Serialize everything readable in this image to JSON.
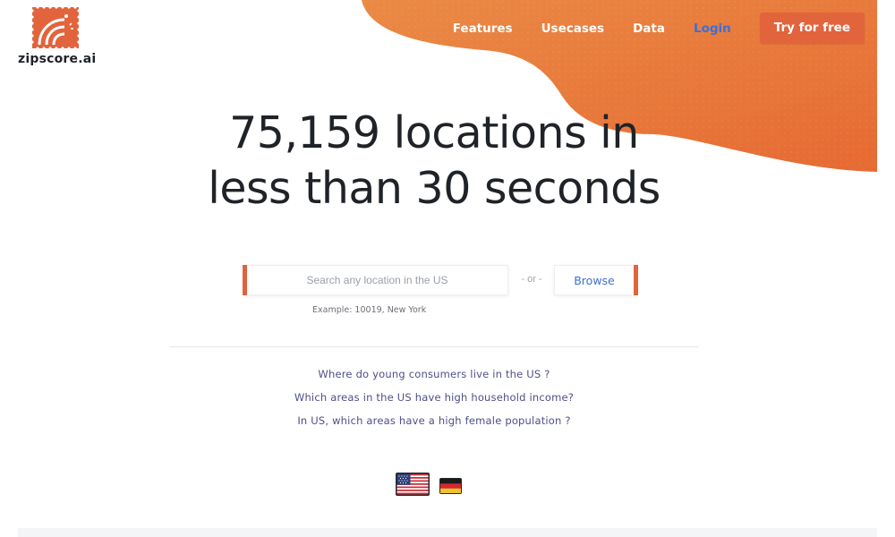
{
  "brand": {
    "name": "zipscore.ai",
    "accent": "#e2643c",
    "blob_color": "#e8773a",
    "link_blue": "#3d6fd4",
    "question_color": "#4f4e8a",
    "logo_icon": "location-pin-stamp-icon"
  },
  "nav": {
    "features": "Features",
    "usecases": "Usecases",
    "data": "Data",
    "login": "Login",
    "cta": "Try for free"
  },
  "hero": {
    "line1": "75,159 locations in",
    "line2": "less than 30 seconds"
  },
  "search": {
    "placeholder": "Search any location in the US",
    "value": "",
    "or_label": "- or -",
    "browse_label": "Browse",
    "example": "Example: 10019, New York"
  },
  "questions": [
    "Where do young consumers live in the US ?",
    "Which areas in the US have high household income?",
    "In US, which areas have a high female population ?"
  ],
  "languages": {
    "us_icon": "us-flag-icon",
    "de_icon": "germany-flag-icon"
  }
}
